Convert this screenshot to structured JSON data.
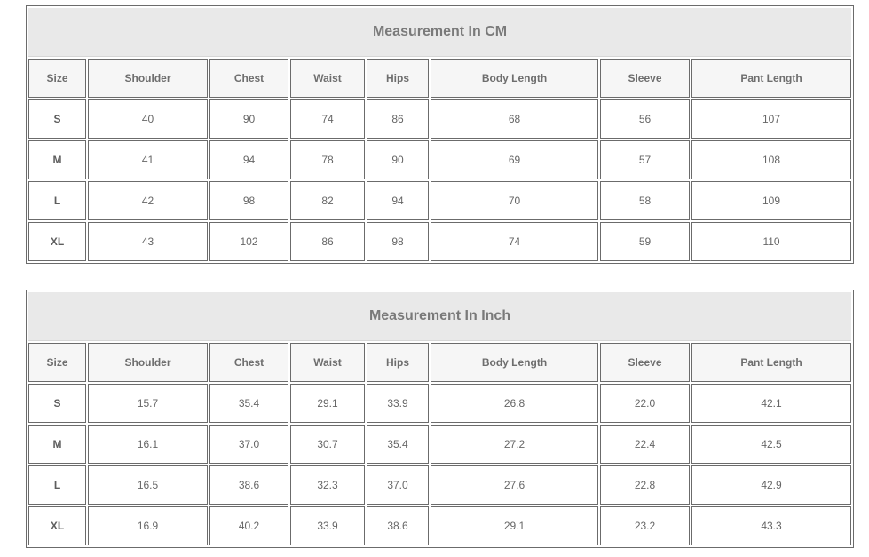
{
  "tables": [
    {
      "title": "Measurement In CM",
      "columns": [
        "Size",
        "Shoulder",
        "Chest",
        "Waist",
        "Hips",
        "Body Length",
        "Sleeve",
        "Pant Length"
      ],
      "rows": [
        [
          "S",
          "40",
          "90",
          "74",
          "86",
          "68",
          "56",
          "107"
        ],
        [
          "M",
          "41",
          "94",
          "78",
          "90",
          "69",
          "57",
          "108"
        ],
        [
          "L",
          "42",
          "98",
          "82",
          "94",
          "70",
          "58",
          "109"
        ],
        [
          "XL",
          "43",
          "102",
          "86",
          "98",
          "74",
          "59",
          "110"
        ]
      ]
    },
    {
      "title": "Measurement In Inch",
      "columns": [
        "Size",
        "Shoulder",
        "Chest",
        "Waist",
        "Hips",
        "Body Length",
        "Sleeve",
        "Pant Length"
      ],
      "rows": [
        [
          "S",
          "15.7",
          "35.4",
          "29.1",
          "33.9",
          "26.8",
          "22.0",
          "42.1"
        ],
        [
          "M",
          "16.1",
          "37.0",
          "30.7",
          "35.4",
          "27.2",
          "22.4",
          "42.5"
        ],
        [
          "L",
          "16.5",
          "38.6",
          "32.3",
          "37.0",
          "27.6",
          "22.8",
          "42.9"
        ],
        [
          "XL",
          "16.9",
          "40.2",
          "33.9",
          "38.6",
          "29.1",
          "23.2",
          "43.3"
        ]
      ]
    }
  ],
  "colors": {
    "border": "#6b6b6b",
    "title_background": "#e9e9e9",
    "header_background": "#f6f6f6",
    "text": "#666666"
  }
}
